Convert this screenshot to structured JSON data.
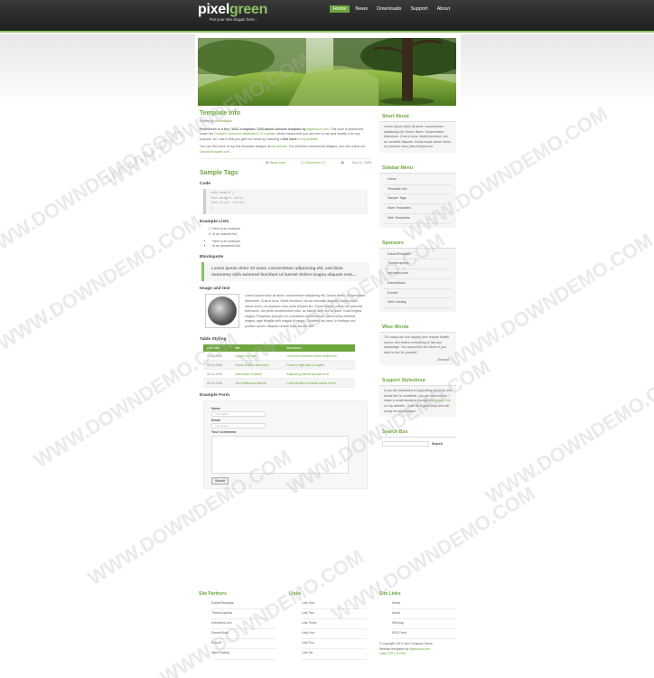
{
  "header": {
    "logo_pre": "pixel",
    "logo_green": "green",
    "slogan": "Put your site slogan here...",
    "nav": [
      "Home",
      "News",
      "Downloads",
      "Support",
      "About"
    ]
  },
  "post": {
    "title": "Template Info",
    "posted_by": "Posted by",
    "author": "erwinaligam",
    "intro": "PixelGreen is a free, W3C-compliant, CSS-based website template by",
    "intro_link": "styleshout.com",
    "license_a": ". This work is distributed under the",
    "license_link": "Creative Commons Attribution 2.5 License",
    "license_b": ", which means that you are free to use and modify it for any purpose. All I ask is that you give me credit by including a",
    "credit_bold": "link back",
    "credit_link": "to my website",
    "more_a": "You can find more of my free template designs at",
    "more_link": "my website",
    "more_b": ". For premium commercial designs, you can check out",
    "more_link2": "DreamTemplate.com",
    "readmore": "Read more",
    "comments": "Comments (7)",
    "date": "Nov 11, 2006"
  },
  "sample": {
    "title": "Sample Tags",
    "code_h": "Code",
    "code_lines": [
      "code-sample {",
      "  font-weight: bold;",
      "  font-style: italic;",
      "}"
    ],
    "lists_h": "Example Lists",
    "ol": [
      "Here is an example",
      "of an ordered list"
    ],
    "ul": [
      "Here is an example",
      "of an unordered list"
    ],
    "bq_h": "Blockquote",
    "blockquote": "Lorem ipsum dolor sit amet, consectetuer adipiscing elit, sed diam nonummy nibh euismod tincidunt ut laoreet dolore magna aliquam erat....",
    "img_h": "Image and text",
    "img_text": "Lorem ipsum dolor sit amet, consectetuer adipiscing elit. Donec libero. Suspendisse bibendum. Cras id urna. Morbi tincidunt, orci ac convallis aliquam, lectus turpis varius lorem, eu posuere nunc justo tempus leo. Donec mattis, purus nec placerat bibendum, dui pede condimentum odio, ac blandit ante orci ut diam. Cras fringilla magna. Phasellus suscipit, leo a pharetra condimentum, lorem tellus eleifend magna, eget fringilla velit magna id neque. Curabitur vel urna. In tristique orci porttitor ipsum. Aliquam ornare diam iaculis nibh.",
    "table_h": "Table Styling",
    "table_cols": [
      "post date",
      "title",
      "description"
    ],
    "table_rows": [
      [
        "05.31.2006",
        "Augue non nibh",
        "Lobortis commodo metus vestibulum"
      ],
      [
        "05.31.2006",
        "Fusce ut diam bibendum",
        "Purus in eget odio in sapien"
      ],
      [
        "05.31.2006",
        "Maecenas et ipsum",
        "Adipiscing blandit quisque eros"
      ],
      [
        "05.31.2006",
        "Sed vestibulum blandit",
        "Cras lobortis commodo metus lorem"
      ]
    ],
    "form_h": "Example Form",
    "form_name": "Name",
    "form_name_ph": "Your Name",
    "form_email": "Email",
    "form_email_ph": "Your Email",
    "form_comments": "Your Comments",
    "form_submit": "Submit"
  },
  "sidebar": {
    "about_h": "Short About",
    "about_text": "Lorem ipsum dolor sit amet, consectetuer adipiscing elit. Donec libero. Suspendisse bibendum. Cras id urna. Morbi tincidunt, orci ac convallis aliquam, lectus turpis varius lorem, eu posuere nunc justo tempus leo.",
    "menu_h": "Sidebar Menu",
    "menu": [
      "Home",
      "Template Info",
      "Sample Tags",
      "More Templates",
      "Web Templates"
    ],
    "sponsors_h": "Sponsors",
    "sponsors": [
      "DreamTemplate",
      "ThemeLayouts",
      "ImHosted.com",
      "DreamStock",
      "Evrsoft",
      "Web Hosting"
    ],
    "wise_h": "Wise Words",
    "wise_text": "\"So many can live happily who require foolish spoon; who learns everything to his own advantage. You cannot live for others if you wish to live for yourself.\"",
    "wise_author": "- Seneca",
    "support_h": "Support Styleshout",
    "support_text": "If you are interested in supporting my work and would like to contribute, you are welcome to make a small donation through the",
    "support_link": "donate link",
    "support_text2": "on my website - it will be a great help and will surely be appreciated.",
    "search_h": "Search Box",
    "search_btn": "Search"
  },
  "footer": {
    "partners_h": "Site Partners",
    "partners": [
      "DreamTemplate",
      "ThemeLayouts",
      "ImHosted.com",
      "DreamStock",
      "Evrsoft",
      "Web Hosting"
    ],
    "links_h": "Links",
    "links": [
      "Link One",
      "Link Two",
      "Link Three",
      "Link Four",
      "Link Five",
      "Link Six"
    ],
    "sitelinks_h": "Site Links",
    "sitelinks": [
      "Home",
      "About",
      "Sitemap",
      "RSS Feed"
    ],
    "copyright": "© copyright 2010 Your Company Name",
    "copyright2": "Website templates by",
    "copyright_link": "styleshout.com",
    "valid": "Valid CSS | XHTML"
  },
  "watermark": "WWW.DOWNDEMO.COM",
  "colors": {
    "accent": "#6ea63e",
    "header": "#2a2a2a"
  }
}
